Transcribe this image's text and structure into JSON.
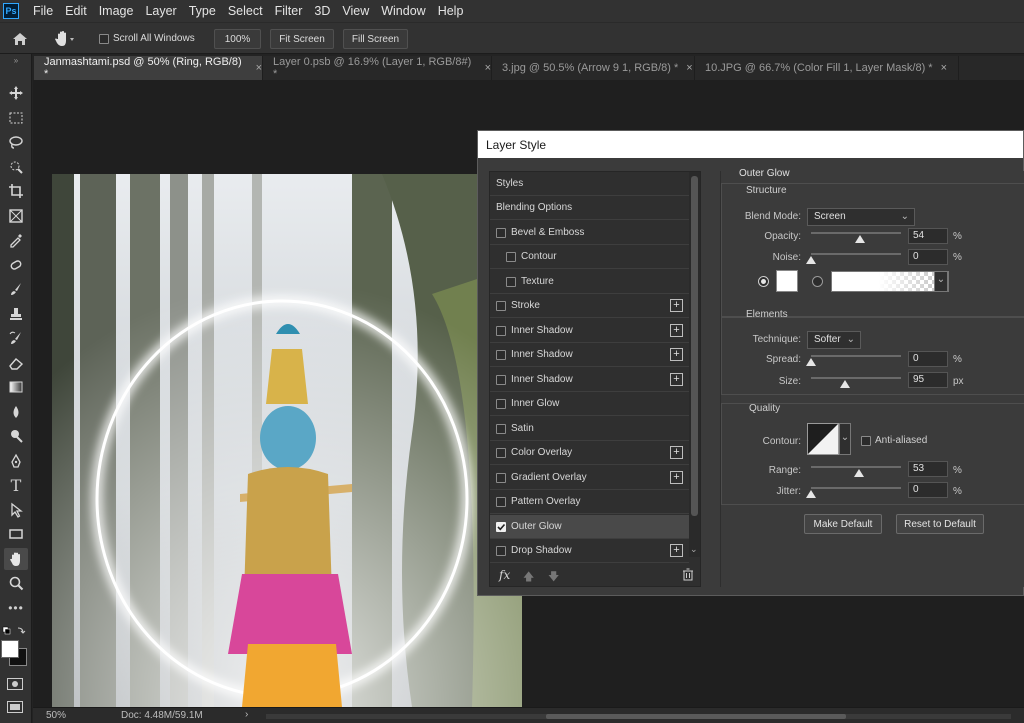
{
  "menu": [
    "File",
    "Edit",
    "Image",
    "Layer",
    "Type",
    "Select",
    "Filter",
    "3D",
    "View",
    "Window",
    "Help"
  ],
  "app_icon": "Ps",
  "options": {
    "scroll_all_label": "Scroll All Windows",
    "zoom_btn": "100%",
    "fit_btn": "Fit Screen",
    "fill_btn": "Fill Screen"
  },
  "tabs": [
    {
      "label": "Janmashtami.psd @ 50% (Ring, RGB/8) *"
    },
    {
      "label": "Layer 0.psb @ 16.9% (Layer 1, RGB/8#) *"
    },
    {
      "label": "3.jpg @ 50.5% (Arrow 9 1, RGB/8) *"
    },
    {
      "label": "10.JPG @ 66.7% (Color Fill 1, Layer Mask/8) *"
    }
  ],
  "status": {
    "zoom": "50%",
    "doc": "Doc: 4.48M/59.1M"
  },
  "dialog": {
    "title": "Layer Style",
    "styles_header": "Styles",
    "blending_options": "Blending Options",
    "items": [
      {
        "label": "Bevel & Emboss",
        "checked": false,
        "plus": false
      },
      {
        "label": "Contour",
        "checked": false,
        "plus": false
      },
      {
        "label": "Texture",
        "checked": false,
        "plus": false
      },
      {
        "label": "Stroke",
        "checked": false,
        "plus": true
      },
      {
        "label": "Inner Shadow",
        "checked": false,
        "plus": true
      },
      {
        "label": "Inner Shadow",
        "checked": false,
        "plus": true
      },
      {
        "label": "Inner Shadow",
        "checked": false,
        "plus": true
      },
      {
        "label": "Inner Glow",
        "checked": false,
        "plus": false
      },
      {
        "label": "Satin",
        "checked": false,
        "plus": false
      },
      {
        "label": "Color Overlay",
        "checked": false,
        "plus": true
      },
      {
        "label": "Gradient Overlay",
        "checked": false,
        "plus": true
      },
      {
        "label": "Pattern Overlay",
        "checked": false,
        "plus": false
      },
      {
        "label": "Outer Glow",
        "checked": true,
        "plus": false
      },
      {
        "label": "Drop Shadow",
        "checked": false,
        "plus": true
      }
    ],
    "fx_label": "fx",
    "panel": {
      "title": "Outer Glow",
      "structure": {
        "label": "Structure",
        "blend_mode_label": "Blend Mode:",
        "blend_mode": "Screen",
        "opacity_label": "Opacity:",
        "opacity": "54",
        "opacity_value": 54,
        "noise_label": "Noise:",
        "noise": "0",
        "noise_value": 0,
        "percent": "%"
      },
      "elements": {
        "label": "Elements",
        "technique_label": "Technique:",
        "technique": "Softer",
        "spread_label": "Spread:",
        "spread": "0",
        "spread_value": 0,
        "size_label": "Size:",
        "size": "95",
        "size_value": 95,
        "px": "px"
      },
      "quality": {
        "label": "Quality",
        "contour_label": "Contour:",
        "anti_aliased_label": "Anti-aliased",
        "range_label": "Range:",
        "range": "53",
        "range_value": 53,
        "jitter_label": "Jitter:",
        "jitter": "0",
        "jitter_value": 0
      },
      "make_default": "Make Default",
      "reset_default": "Reset to Default"
    }
  }
}
